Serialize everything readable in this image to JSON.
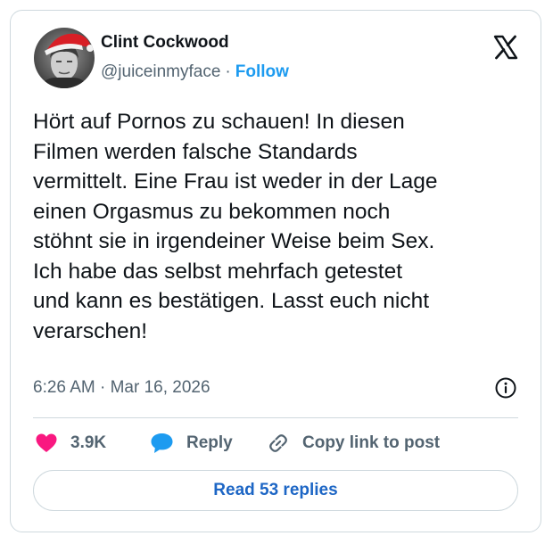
{
  "author": {
    "display_name": "Clint Cockwood",
    "handle": "@juiceinmyface",
    "separator": "·",
    "follow_label": "Follow"
  },
  "tweet": {
    "lines": [
      "Hört auf Pornos zu schauen! In diesen",
      "Filmen werden falsche Standards",
      "vermittelt. Eine Frau ist weder in der Lage",
      "einen Orgasmus zu bekommen noch",
      "stöhnt sie in irgendeiner Weise beim Sex.",
      "Ich habe das selbst mehrfach getestet",
      "und kann es bestätigen. Lasst euch nicht",
      "verarschen!"
    ],
    "timestamp": "6:26 AM · Mar 16, 2026"
  },
  "actions": {
    "like_count": "3.9K",
    "reply_label": "Reply",
    "copy_link_label": "Copy link to post"
  },
  "footer": {
    "read_replies_label": "Read 53 replies"
  },
  "icons": {
    "like": "heart-icon",
    "reply": "speech-bubble-icon",
    "copy": "link-icon",
    "info": "info-icon",
    "brand": "x-logo-icon"
  },
  "colors": {
    "accent": "#1d9bf0",
    "like": "#f91880",
    "reply": "#1d9bf0",
    "muted": "#536471",
    "border": "#cfd9de"
  }
}
